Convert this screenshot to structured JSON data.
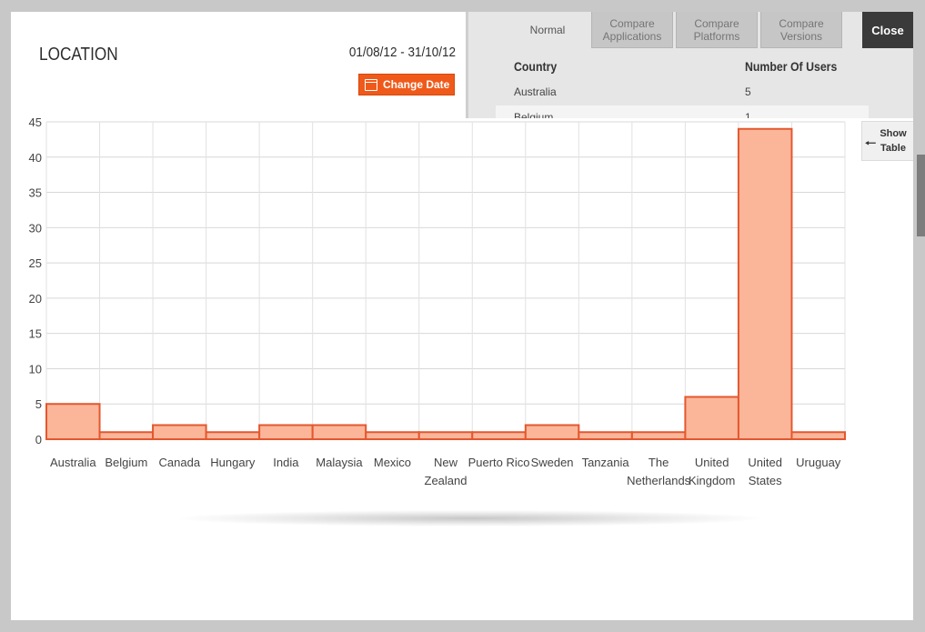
{
  "modal": {
    "title": "LOCATION",
    "date_range": "01/08/12 - 31/10/12",
    "change_date_label": "Change Date",
    "close_label": "Close",
    "show_table_label": "Show Table"
  },
  "tabs": [
    {
      "label": "Normal",
      "active": true
    },
    {
      "label": "Compare Applications",
      "active": false
    },
    {
      "label": "Compare Platforms",
      "active": false
    },
    {
      "label": "Compare Versions",
      "active": false
    }
  ],
  "table": {
    "col_country": "Country",
    "col_users": "Number Of Users",
    "rows": [
      {
        "country": "Australia",
        "users": "5"
      },
      {
        "country": "Belgium",
        "users": "1"
      }
    ]
  },
  "colors": {
    "accent": "#ef5a1a",
    "bar_fill": "#fbb69a",
    "bar_stroke": "#e4572e"
  },
  "chart_data": {
    "type": "bar",
    "categories": [
      "Australia",
      "Belgium",
      "Canada",
      "Hungary",
      "India",
      "Malaysia",
      "Mexico",
      "New Zealand",
      "Puerto Rico",
      "Sweden",
      "Tanzania",
      "The Netherlands",
      "United Kingdom",
      "United States",
      "Uruguay"
    ],
    "values": [
      5,
      1,
      2,
      1,
      2,
      2,
      1,
      1,
      1,
      2,
      1,
      1,
      6,
      44,
      1
    ],
    "ylim": [
      0,
      45
    ],
    "yticks": [
      0,
      5,
      10,
      15,
      20,
      25,
      30,
      35,
      40,
      45
    ],
    "grid": true,
    "title": "",
    "xlabel": "",
    "ylabel": ""
  }
}
